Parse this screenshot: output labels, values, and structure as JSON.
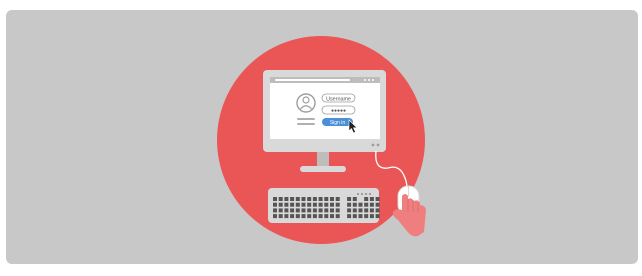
{
  "login_form": {
    "username_label": "Username",
    "password_mask": "●●●●●",
    "signin_label": "Sign in"
  },
  "colors": {
    "background": "#c8c8c8",
    "circle": "#ea5656",
    "monitor_frame": "#d9d9d9",
    "screen": "#ffffff",
    "signin_button": "#4a90d9",
    "hand": "#ef7f7f"
  },
  "icons": [
    "user-avatar-icon",
    "mouse-cursor-icon",
    "window-control-dots-icon"
  ]
}
